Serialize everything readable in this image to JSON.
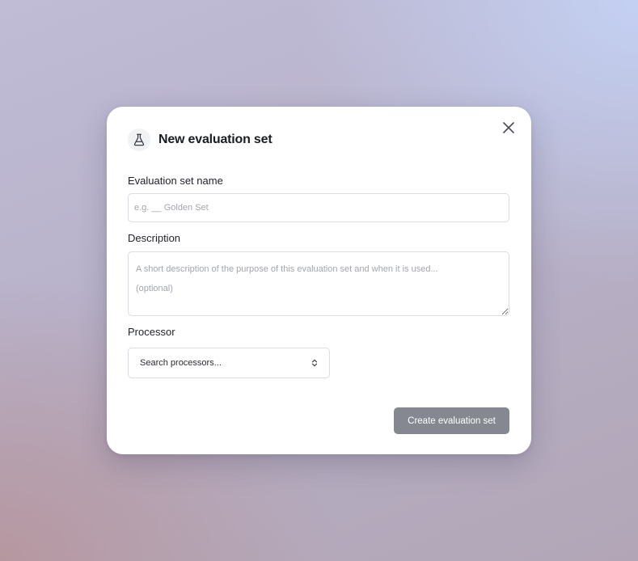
{
  "dialog": {
    "title": "New evaluation set",
    "header_icon": "flask-icon",
    "close_icon": "close-icon"
  },
  "form": {
    "name": {
      "label": "Evaluation set name",
      "value": "",
      "placeholder": "e.g. __ Golden Set"
    },
    "description": {
      "label": "Description",
      "value": "",
      "placeholder": "A short description of the purpose of this evaluation set and when it is used...\n(optional)"
    },
    "processor": {
      "label": "Processor",
      "placeholder": "Search processors...",
      "icon": "chevron-up-down-icon"
    }
  },
  "actions": {
    "create_label": "Create evaluation set"
  },
  "colors": {
    "button_disabled_bg": "#858891",
    "title_text": "#1b1d24",
    "border": "#dcdde2"
  }
}
